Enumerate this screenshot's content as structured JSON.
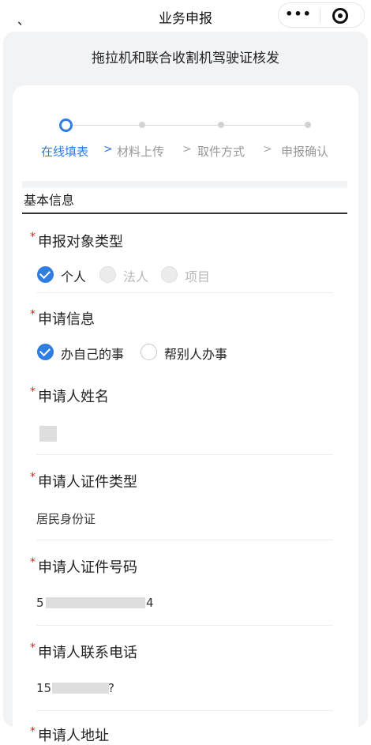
{
  "nav": {
    "back": "、",
    "title": "业务申报",
    "more": "•••"
  },
  "page_title": "拖拉机和联合收割机驾驶证核发",
  "steps": [
    {
      "label": "在线填表",
      "active": true
    },
    {
      "label": "材料上传",
      "active": false
    },
    {
      "label": "取件方式",
      "active": false
    },
    {
      "label": "申报确认",
      "active": false
    }
  ],
  "step_separator": ">",
  "section_title": "基本信息",
  "required_mark": "*",
  "fields": {
    "applicant_type": {
      "label": "申报对象类型",
      "options": [
        {
          "label": "个人",
          "state": "checked"
        },
        {
          "label": "法人",
          "state": "disabled"
        },
        {
          "label": "项目",
          "state": "disabled"
        }
      ]
    },
    "apply_info": {
      "label": "申请信息",
      "options": [
        {
          "label": "办自己的事",
          "state": "checked"
        },
        {
          "label": "帮别人办事",
          "state": "unchecked"
        }
      ]
    },
    "applicant_name": {
      "label": "申请人姓名",
      "value": ""
    },
    "id_type": {
      "label": "申请人证件类型",
      "value": "居民身份证"
    },
    "id_number": {
      "label": "申请人证件号码",
      "value_start": "5",
      "value_end": "4"
    },
    "phone": {
      "label": "申请人联系电话",
      "value_start": "15",
      "value_end": "?"
    },
    "address": {
      "label": "申请人地址"
    }
  },
  "colors": {
    "accent": "#2f7de1",
    "required": "#e02020",
    "panel_bg": "#f2f3f5"
  }
}
